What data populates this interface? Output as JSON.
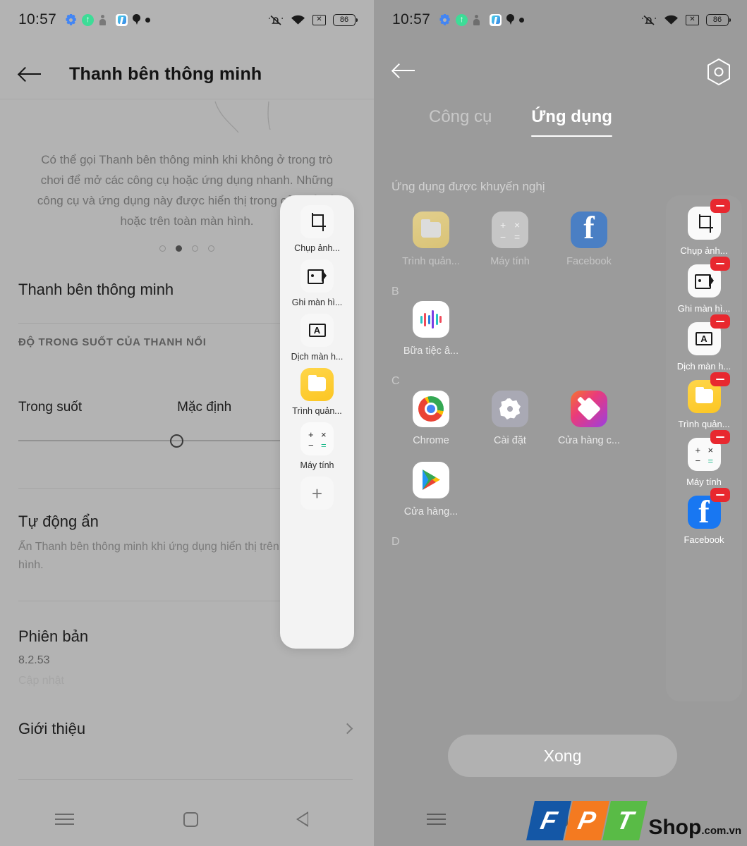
{
  "left_screen": {
    "status_bar": {
      "time": "10:57",
      "left_icons": [
        "settings-gear-icon",
        "green-upload-icon",
        "contacts-icon",
        "blue-app-icon",
        "location-pin-icon",
        "dot-icon"
      ],
      "right_icons": [
        "mute-bell-icon",
        "wifi-icon",
        "signal-off-icon"
      ],
      "battery": "86"
    },
    "appbar": {
      "back_icon": "back-arrow-icon",
      "title": "Thanh bên thông minh"
    },
    "description": "Có thể gọi Thanh bên thông minh khi không ở trong trò chơi để mở các công cụ hoặc ứng dụng nhanh. Những công cụ và ứng dụng này được hiển thị trong cửa sổ nổi hoặc trên toàn màn hình.",
    "pager": {
      "total": 4,
      "active_index": 1
    },
    "settings": {
      "main_toggle_label": "Thanh bên thông minh",
      "section_header": "ĐỘ TRONG SUỐT CỦA THANH NỔI",
      "slider_left_label": "Trong suốt",
      "slider_right_label": "Mặc định",
      "slider_value_percent": 50,
      "auto_hide_title": "Tự động ẩn",
      "auto_hide_sub": "Ẩn Thanh bên thông minh khi ứng dụng hiển thị trên toàn màn hình.",
      "version_title": "Phiên bản",
      "version_value": "8.2.53",
      "version_update": "Cập nhật",
      "about_title": "Giới thiệu",
      "about_chevron": "chevron-right-icon"
    },
    "floating_bar": {
      "items": [
        {
          "label": "Chụp ảnh...",
          "icon": "crop-screenshot-icon"
        },
        {
          "label": "Ghi màn hì...",
          "icon": "screen-record-icon"
        },
        {
          "label": "Dịch màn h...",
          "icon": "screen-translate-icon"
        },
        {
          "label": "Trình quản...",
          "icon": "file-manager-icon"
        },
        {
          "label": "Máy tính",
          "icon": "calculator-icon"
        }
      ],
      "add_label": "+",
      "add_icon": "plus-icon"
    },
    "navbar": {
      "recent_icon": "recent-apps-icon",
      "home_icon": "home-square-icon",
      "back_icon": "back-triangle-icon"
    }
  },
  "right_screen": {
    "status_bar": {
      "time": "10:57",
      "battery": "86"
    },
    "appbar": {
      "back_icon": "back-arrow-icon",
      "settings_icon": "settings-hex-icon"
    },
    "tabs": [
      {
        "label": "Công cụ",
        "active": false
      },
      {
        "label": "Ứng dụng",
        "active": true
      }
    ],
    "recommended_label": "Ứng dụng được khuyến nghị",
    "recommended_apps": [
      {
        "label": "Trình quản...",
        "icon": "file-manager-icon",
        "dim": true
      },
      {
        "label": "Máy tính",
        "icon": "calculator-icon",
        "dim": true
      },
      {
        "label": "Facebook",
        "icon": "facebook-icon",
        "dim": true
      }
    ],
    "sections": [
      {
        "letter": "B",
        "apps": [
          {
            "label": "Bữa tiệc â...",
            "icon": "audio-waveform-icon"
          }
        ]
      },
      {
        "letter": "C",
        "apps": [
          {
            "label": "Chrome",
            "icon": "chrome-icon"
          },
          {
            "label": "Cài đặt",
            "icon": "settings-flower-icon"
          },
          {
            "label": "Cửa hàng c...",
            "icon": "theme-store-icon"
          },
          {
            "label": "Cửa hàng...",
            "icon": "play-store-icon"
          }
        ]
      },
      {
        "letter": "D",
        "apps": []
      }
    ],
    "edit_panel": {
      "items": [
        {
          "label": "Chụp ảnh...",
          "icon": "crop-screenshot-icon",
          "remove_icon": "remove-minus-icon"
        },
        {
          "label": "Ghi màn hì...",
          "icon": "screen-record-icon",
          "remove_icon": "remove-minus-icon"
        },
        {
          "label": "Dịch màn h...",
          "icon": "screen-translate-icon",
          "remove_icon": "remove-minus-icon"
        },
        {
          "label": "Trình quản...",
          "icon": "file-manager-icon",
          "remove_icon": "remove-minus-icon"
        },
        {
          "label": "Máy tính",
          "icon": "calculator-icon",
          "remove_icon": "remove-minus-icon"
        },
        {
          "label": "Facebook",
          "icon": "facebook-icon",
          "remove_icon": "remove-minus-icon"
        }
      ]
    },
    "done_button": "Xong",
    "navbar": {
      "recent_icon": "recent-apps-icon",
      "home_icon": "home-square-icon"
    }
  },
  "watermark": {
    "letters": [
      "F",
      "P",
      "T"
    ],
    "text": "Shop",
    "suffix": ".com.vn"
  },
  "colors": {
    "accent_red": "#e8282f",
    "facebook_blue": "#1877f2",
    "folder_yellow": "#fcc623",
    "fpt_blue": "#1457a6",
    "fpt_orange": "#f47a20",
    "fpt_green": "#59bb46"
  }
}
